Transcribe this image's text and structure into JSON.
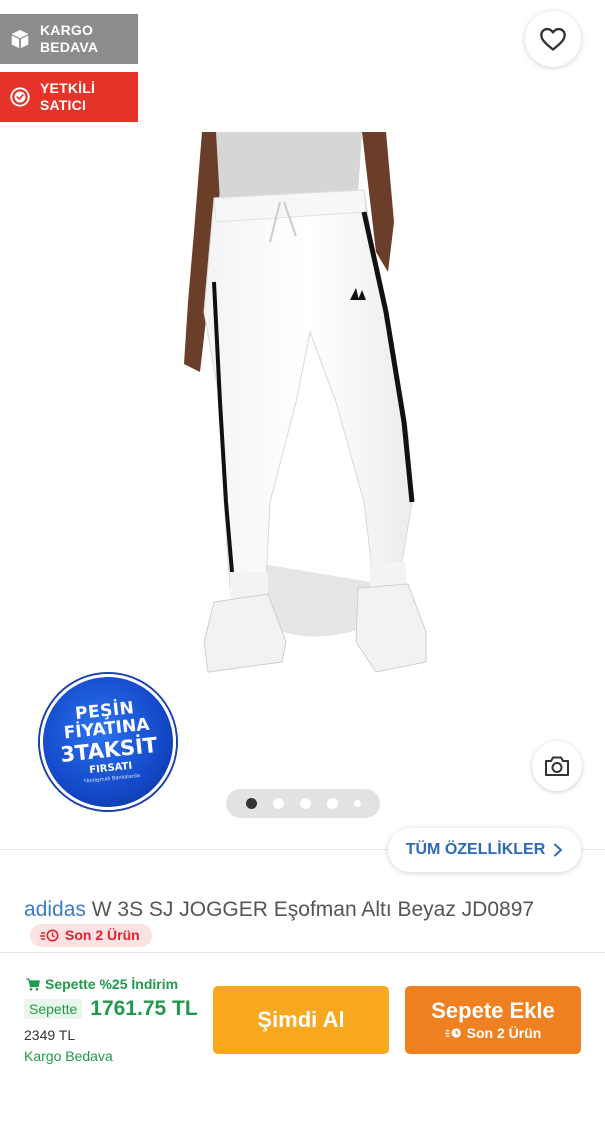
{
  "badges": {
    "cargo": "KARGO BEDAVA",
    "seller": "YETKİLİ SATICI",
    "cargo_icon": "box-icon",
    "seller_icon": "verified-check-icon"
  },
  "favorite": {
    "icon": "heart-icon"
  },
  "promo": {
    "line1": "PEŞİN",
    "line2": "FİYATINA",
    "line3": "3TAKSİT",
    "line4": "FIRSATI",
    "line5": "*Anlaşmalı Bankalarda"
  },
  "gallery": {
    "active_index": 0,
    "count": 5
  },
  "all_features": {
    "label": "TÜM ÖZELLİKLER"
  },
  "product": {
    "brand": "adidas",
    "name": "W 3S SJ JOGGER Eşofman Altı Beyaz JD0897",
    "stock": "Son 2 Ürün"
  },
  "pricing": {
    "discount_text": "Sepette %25 İndirim",
    "basket_label": "Sepette",
    "price": "1761.75 TL",
    "old_price": "2349 TL",
    "shipping": "Kargo Bedava"
  },
  "actions": {
    "buy_now": "Şimdi Al",
    "add_to_cart": "Sepete Ekle",
    "add_to_cart_sub": "Son 2 Ürün"
  },
  "colors": {
    "cargo_badge": "#8c8c8c",
    "seller_badge": "#e6332a",
    "buy_now": "#f8a81e",
    "add_to_cart": "#f08121",
    "price_green": "#1f9a4a",
    "link_blue": "#2c6ab8"
  }
}
